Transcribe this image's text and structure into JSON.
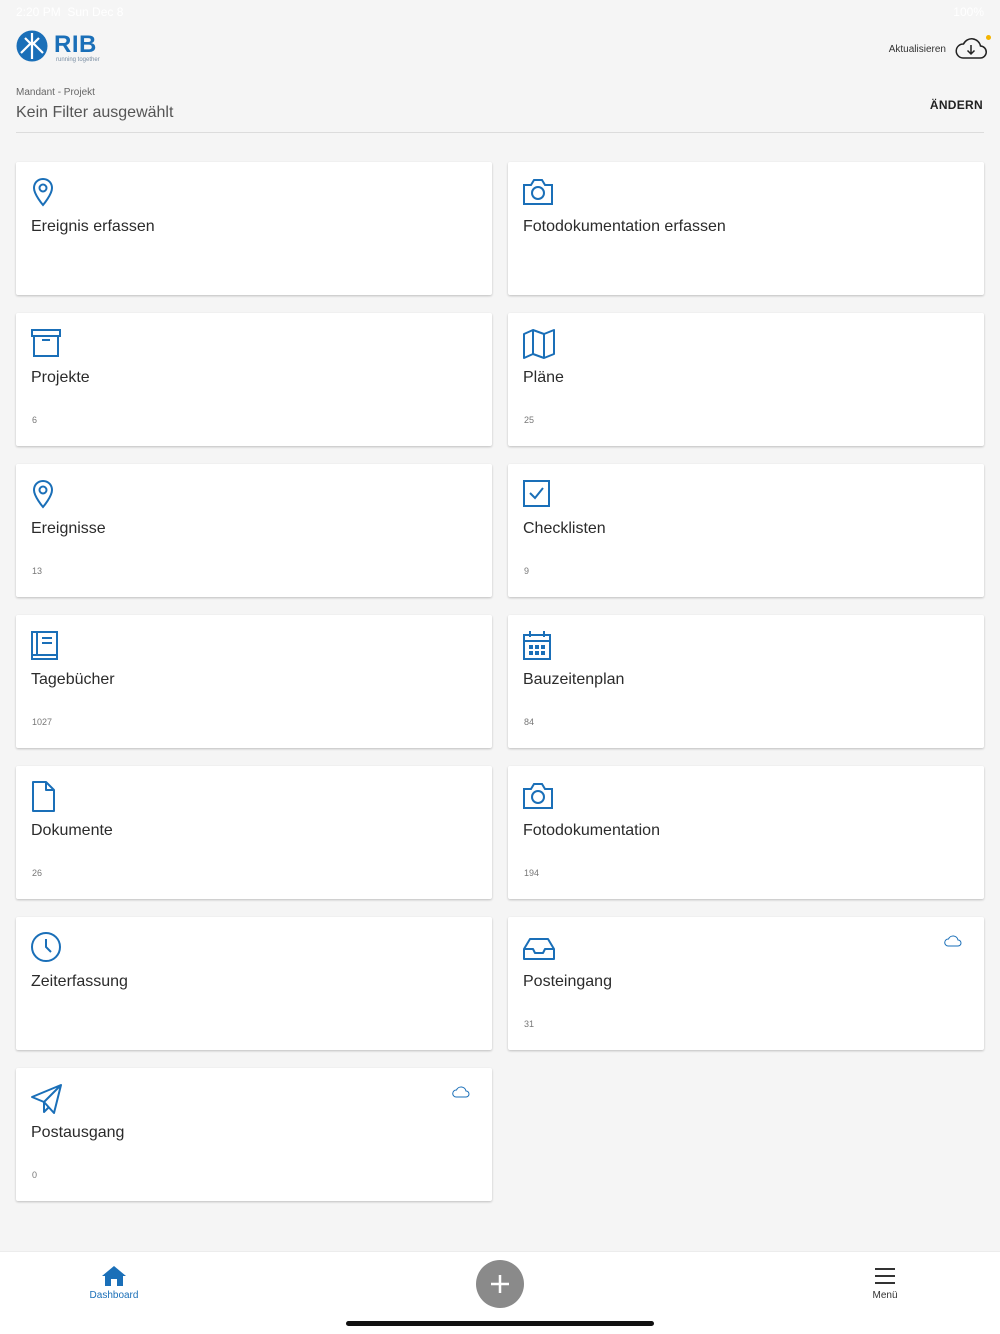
{
  "status": {
    "time": "2:20 PM",
    "date": "Sun Dec 8",
    "battery": "100%"
  },
  "brand": {
    "name": "RIB",
    "tagline": "running together",
    "color": "#1a6fb8"
  },
  "header": {
    "refresh_label": "Aktualisieren",
    "refresh_icon": "cloud-download-icon",
    "notification_color": "#f4b400"
  },
  "filter": {
    "caption": "Mandant - Projekt",
    "value": "Kein Filter ausgewählt",
    "change_label": "ÄNDERN"
  },
  "tiles": [
    {
      "title": "Ereignis erfassen",
      "count": "",
      "icon": "map-pin-icon"
    },
    {
      "title": "Fotodokumentation erfassen",
      "count": "",
      "icon": "camera-icon"
    },
    {
      "title": "Projekte",
      "count": "6",
      "icon": "archive-box-icon"
    },
    {
      "title": "Pläne",
      "count": "25",
      "icon": "map-icon"
    },
    {
      "title": "Ereignisse",
      "count": "13",
      "icon": "map-pin-icon"
    },
    {
      "title": "Checklisten",
      "count": "9",
      "icon": "checkbox-icon"
    },
    {
      "title": "Tagebücher",
      "count": "1027",
      "icon": "book-icon"
    },
    {
      "title": "Bauzeitenplan",
      "count": "84",
      "icon": "calendar-icon"
    },
    {
      "title": "Dokumente",
      "count": "26",
      "icon": "document-icon"
    },
    {
      "title": "Fotodokumentation",
      "count": "194",
      "icon": "camera-icon"
    },
    {
      "title": "Zeiterfassung",
      "count": "",
      "icon": "clock-icon"
    },
    {
      "title": "Posteingang",
      "count": "31",
      "icon": "inbox-icon",
      "cloud": true
    },
    {
      "title": "Postausgang",
      "count": "0",
      "icon": "paper-plane-icon",
      "cloud": true
    }
  ],
  "nav": {
    "dashboard_label": "Dashboard",
    "menu_label": "Menü",
    "add_icon": "plus-icon",
    "active_color": "#1a6fb8"
  }
}
